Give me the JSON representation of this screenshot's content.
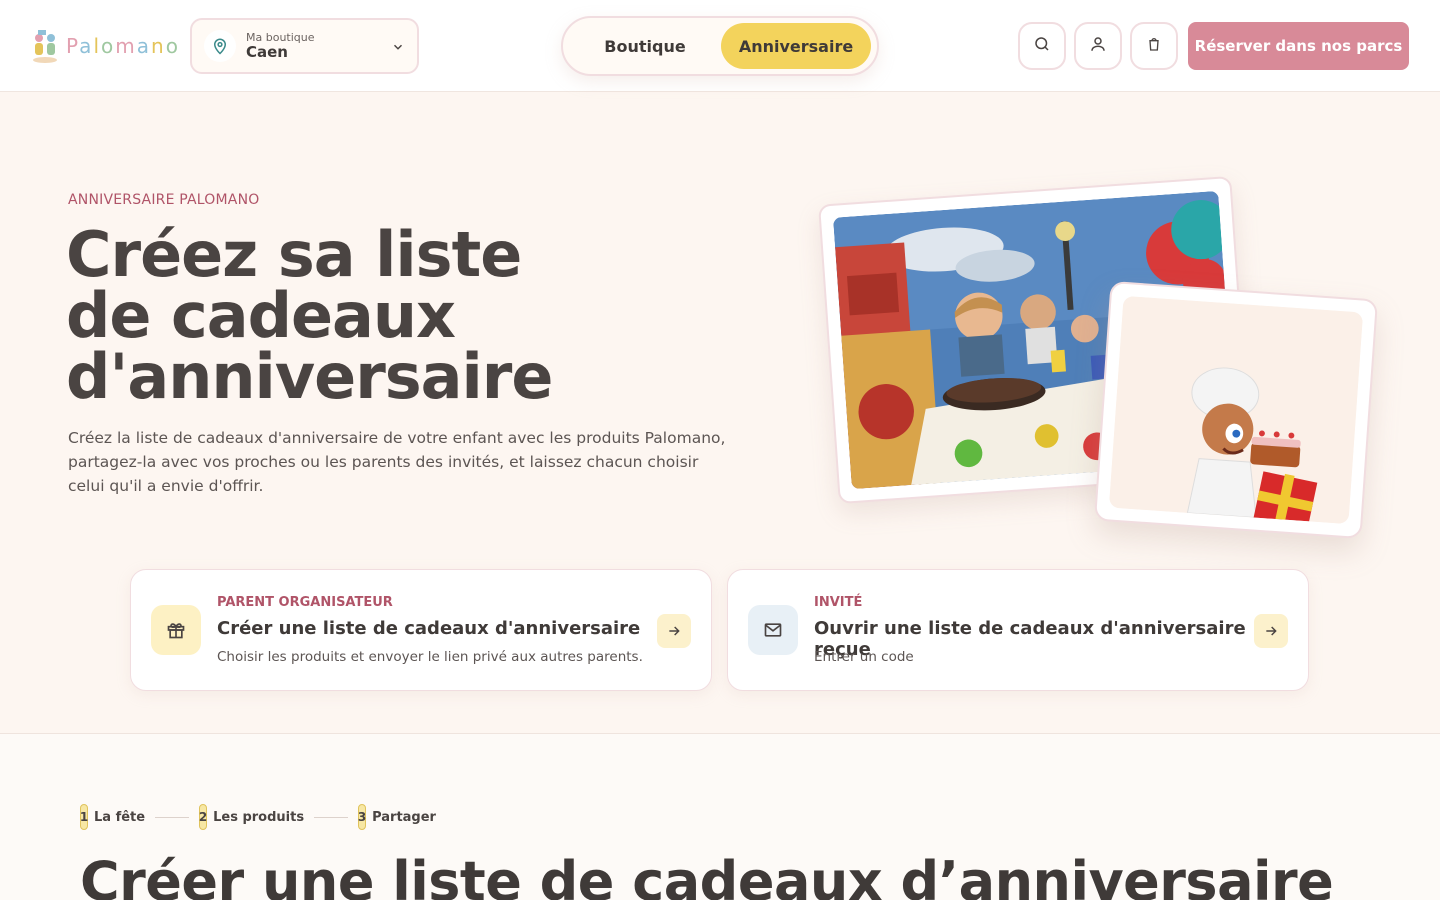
{
  "header": {
    "logo_letters": [
      "P",
      "a",
      "l",
      "o",
      "m",
      "a",
      "n",
      "o"
    ],
    "store": {
      "label": "Ma boutique",
      "value": "Caen"
    },
    "tabs": [
      {
        "label": "Boutique",
        "active": false
      },
      {
        "label": "Anniversaire",
        "active": true
      }
    ],
    "icons": [
      "search-icon",
      "user-icon",
      "shopping-bag-icon"
    ],
    "cta_label": "Réserver dans nos parcs"
  },
  "hero": {
    "eyebrow": "ANNIVERSAIRE PALOMANO",
    "title_line1": "Créez sa liste",
    "title_line2": "de cadeaux",
    "title_line3": "d'anniversaire",
    "description": "Créez la liste de cadeaux d'anniversaire de votre enfant avec les produits Palomano, partagez-la avec vos proches ou les parents des invités, et laissez chacun choisir celui qu'il a envie d'offrir."
  },
  "options": [
    {
      "kicker": "PARENT ORGANISATEUR",
      "title": "Créer une liste de cadeaux d'anniversaire",
      "subtitle": "Choisir les produits et envoyer le lien privé aux autres parents.",
      "icon": "gift-icon"
    },
    {
      "kicker": "INVITÉ",
      "title": "Ouvrir une liste de cadeaux d'anniversaire reçue",
      "subtitle": "Entrer un code",
      "icon": "mail-icon"
    }
  ],
  "steps": [
    {
      "num": "1",
      "label": "La fête"
    },
    {
      "num": "2",
      "label": "Les produits"
    },
    {
      "num": "3",
      "label": "Partager"
    }
  ],
  "section_title": "Créer une liste de cadeaux d’anniversaire",
  "colors": {
    "accent_yellow": "#f3d35c",
    "accent_pink": "#d88a98",
    "kicker_red": "#b05468",
    "background": "#fdf6f1"
  }
}
